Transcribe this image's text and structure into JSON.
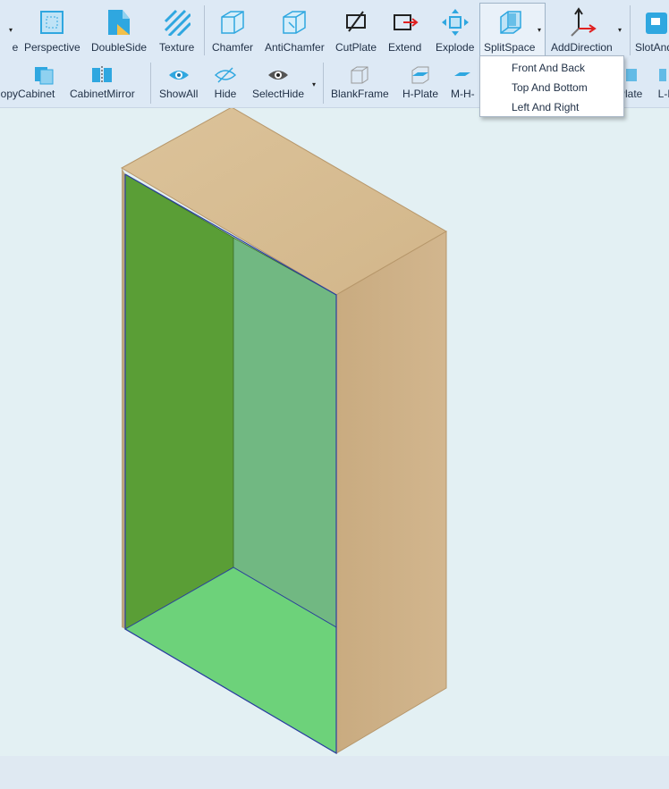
{
  "toolbar1": {
    "items": [
      {
        "label": "e"
      },
      {
        "label": "Perspective"
      },
      {
        "label": "DoubleSide"
      },
      {
        "label": "Texture"
      },
      {
        "label": "Chamfer"
      },
      {
        "label": "AntiChamfer"
      },
      {
        "label": "CutPlate"
      },
      {
        "label": "Extend"
      },
      {
        "label": "Explode"
      },
      {
        "label": "SplitSpace"
      },
      {
        "label": "AddDirection"
      },
      {
        "label": "SlotAnd"
      }
    ]
  },
  "toolbar2": {
    "items": [
      {
        "label": "opyCabinet"
      },
      {
        "label": "CabinetMirror"
      },
      {
        "label": "ShowAll"
      },
      {
        "label": "Hide"
      },
      {
        "label": "SelectHide"
      },
      {
        "label": "BlankFrame"
      },
      {
        "label": "H-Plate"
      },
      {
        "label": "M-H-"
      },
      {
        "label": "Plate"
      },
      {
        "label": "L-P"
      }
    ]
  },
  "splitspace_menu": {
    "options": [
      "Front And Back",
      "Top And Bottom",
      "Left And Right"
    ]
  },
  "colors": {
    "ribbon": "#dde9f5",
    "viewport": "#e3f0f3",
    "accent": "#2fa7e0",
    "wood": "#d7bd92",
    "panel_back": "#5a9e36",
    "panel_side": "#71b882",
    "panel_bottom": "#6dd27a"
  }
}
